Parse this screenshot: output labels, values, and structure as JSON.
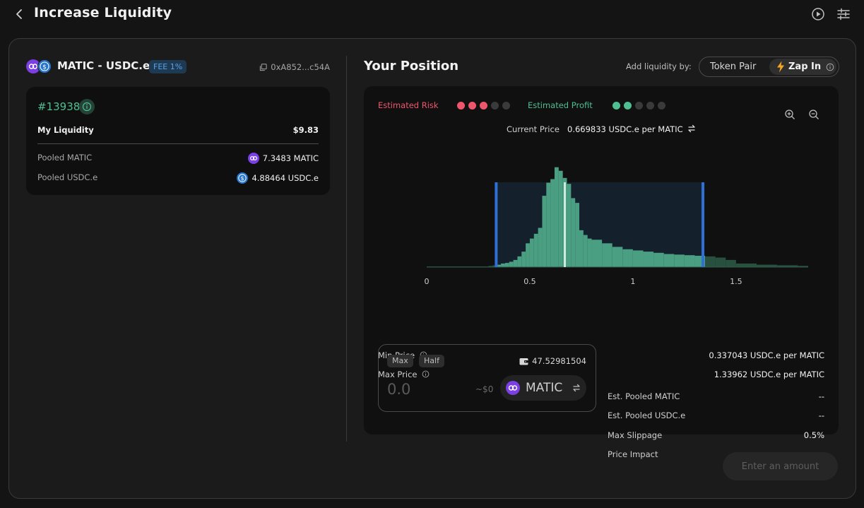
{
  "header": {
    "title": "Increase Liquidity"
  },
  "pool": {
    "pair": "MATIC - USDC.e",
    "fee": "FEE 1%",
    "address": "0xA852...c54A"
  },
  "position": {
    "id": "#13938",
    "my_liquidity_label": "My Liquidity",
    "my_liquidity_value": "$9.83",
    "pooled": [
      {
        "label": "Pooled MATIC",
        "value": "7.3483 MATIC",
        "token": "matic"
      },
      {
        "label": "Pooled USDC.e",
        "value": "4.88464 USDC.e",
        "token": "usdc"
      }
    ]
  },
  "right": {
    "title": "Your Position",
    "add_by_label": "Add liquidity by:",
    "options": [
      "Token Pair",
      "Zap In"
    ],
    "selected_option": "Zap In"
  },
  "indicators": {
    "risk_label": "Estimated Risk",
    "risk_level": 3,
    "profit_label": "Estimated Profit",
    "profit_level": 2,
    "max_level": 5
  },
  "current_price": {
    "label": "Current Price",
    "value": "0.669833 USDC.e per MATIC"
  },
  "chart_data": {
    "type": "bar",
    "x": [
      0.0,
      0.05,
      0.1,
      0.15,
      0.2,
      0.25,
      0.3,
      0.32,
      0.34,
      0.36,
      0.38,
      0.4,
      0.42,
      0.44,
      0.46,
      0.48,
      0.5,
      0.52,
      0.54,
      0.56,
      0.58,
      0.6,
      0.62,
      0.64,
      0.66,
      0.68,
      0.7,
      0.72,
      0.74,
      0.76,
      0.78,
      0.8,
      0.85,
      0.9,
      0.95,
      1.0,
      1.05,
      1.1,
      1.15,
      1.2,
      1.25,
      1.3,
      1.35,
      1.4,
      1.45,
      1.5,
      1.6,
      1.7,
      1.8
    ],
    "values": [
      1,
      1,
      1,
      1,
      1,
      1,
      2,
      3,
      4,
      6,
      7,
      9,
      12,
      18,
      26,
      40,
      48,
      56,
      66,
      120,
      142,
      148,
      168,
      162,
      150,
      140,
      116,
      108,
      62,
      54,
      48,
      46,
      40,
      34,
      30,
      28,
      26,
      24,
      22,
      21,
      20,
      19,
      18,
      16,
      12,
      6,
      4,
      3,
      2
    ],
    "xlim": [
      0,
      1.85
    ],
    "ylim": [
      0,
      170
    ],
    "xticks": [
      "0",
      "0.5",
      "1",
      "1.5"
    ],
    "xtick_values": [
      0,
      0.5,
      1,
      1.5
    ],
    "range_min": 0.337043,
    "range_max": 1.33962,
    "current_price": 0.669833,
    "in_range_color": "#4a9e82",
    "out_range_color": "#28503f",
    "range_bg": "#14202c",
    "range_line_color": "#2f6fd6",
    "current_line_color": "#cfe9df"
  },
  "prices": {
    "min_label": "Min Price",
    "min_value": "0.337043 USDC.e per MATIC",
    "max_label": "Max Price",
    "max_value": "1.33962 USDC.e per MATIC"
  },
  "input": {
    "max_label": "Max",
    "half_label": "Half",
    "balance": "47.52981504",
    "placeholder": "0.0",
    "usd": "~$0",
    "token": "MATIC"
  },
  "stats": [
    {
      "label": "Est. Pooled MATIC",
      "value": "--"
    },
    {
      "label": "Est. Pooled USDC.e",
      "value": "--"
    },
    {
      "label": "Max Slippage",
      "value": "0.5%"
    },
    {
      "label": "Price Impact",
      "value": "--"
    }
  ],
  "submit": {
    "label": "Enter an amount"
  },
  "colors": {
    "accent_green": "#4fbf93",
    "risk_red": "#f0566b",
    "matic_purple": "#7b3fe4",
    "usdc_blue": "#2775ca",
    "zap_orange": "#f5a623"
  }
}
